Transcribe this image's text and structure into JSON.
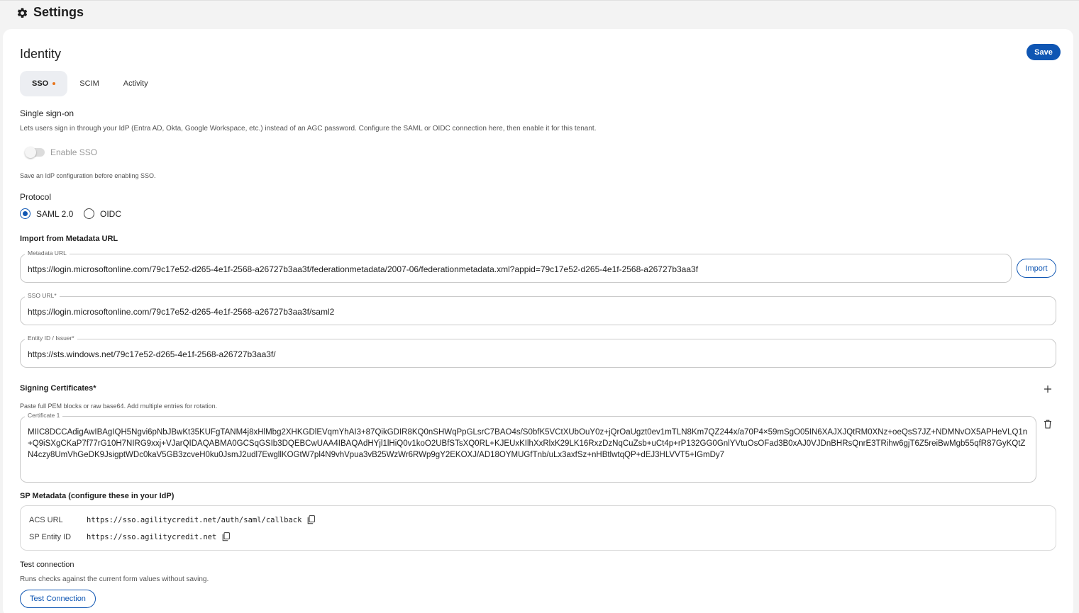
{
  "header": {
    "title": "Settings",
    "icon": "gear-icon"
  },
  "identity": {
    "title": "Identity",
    "save_label": "Save",
    "tabs": [
      {
        "label": "SSO",
        "active": true,
        "modified_indicator": true
      },
      {
        "label": "SCIM",
        "active": false
      },
      {
        "label": "Activity",
        "active": false
      }
    ]
  },
  "sso": {
    "title": "Single sign-on",
    "description": "Lets users sign in through your IdP (Entra AD, Okta, Google Workspace, etc.) instead of an AGC password. Configure the SAML or OIDC connection here, then enable it for this tenant.",
    "enable_label": "Enable SSO",
    "enabled": false,
    "enable_hint": "Save an IdP configuration before enabling SSO."
  },
  "protocol": {
    "label": "Protocol",
    "options": [
      "SAML 2.0",
      "OIDC"
    ],
    "selected": "SAML 2.0"
  },
  "metadata_import": {
    "title": "Import from Metadata URL",
    "field_label": "Metadata URL",
    "value": "https://login.microsoftonline.com/79c17e52-d265-4e1f-2568-a26727b3aa3f/federationmetadata/2007-06/federationmetadata.xml?appid=79c17e52-d265-4e1f-2568-a26727b3aa3f",
    "import_label": "Import"
  },
  "sso_url": {
    "label": "SSO URL*",
    "value": "https://login.microsoftonline.com/79c17e52-d265-4e1f-2568-a26727b3aa3f/saml2"
  },
  "entity_id": {
    "label": "Entity ID / Issuer*",
    "value": "https://sts.windows.net/79c17e52-d265-4e1f-2568-a26727b3aa3f/"
  },
  "certificates": {
    "title": "Signing Certificates*",
    "hint": "Paste full PEM blocks or raw base64. Add multiple entries for rotation.",
    "items": [
      {
        "label": "Certificate 1",
        "value": "MIIC8DCCAdigAwIBAgIQH5Ngvi6pNbJBwKt35KUFgTANM4j8xHlMbg2XHKGDlEVqmYhAI3+87QikGDIR8KQ0nSHWqPpGLsrC7BAO4s/S0bfK5VCtXUbOuY0z+jQrOaUgzt0ev1mTLN8Km7QZ244x/a70P4×59mSgO05IN6XAJXJQtRM0XNz+oeQsS7JZ+NDMNvOX5APHeVLQ1n+Q9iSXgCKaP7f77rG10H7NIRG9xxj+VJarQIDAQABMA0GCSqGSIb3DQEBCwUAA4IBAQAdHYjl1lHiQ0v1koO2UBfSTsXQ0RL+KJEUxKIlhXxRlxK29LK16RxzDzNqCuZsb+uCt4p+rP132GG0GnlYVtuOsOFad3B0xAJ0VJDnBHRsQnrE3TRihw6gjT6Z5reiBwMgb55qfR87GyKQtZN4czy8UmVhGeDK9JsigptWDc0kaV5GB3zcveH0ku0JsmJ2udl7EwgllKOGtW7pl4N9vhVpua3vB25WzWr6RWp9gY2EKOXJ/AD18OYMUGfTnb/uLx3axfSz+nHBtlwtqQP+dEJ3HLVVT5+IGmDy7"
      }
    ],
    "add_icon": "plus-icon",
    "delete_icon": "trash-icon"
  },
  "sp_metadata": {
    "title": "SP Metadata (configure these in your IdP)",
    "rows": [
      {
        "key": "ACS URL",
        "value": "https://sso.agilitycredit.net/auth/saml/callback"
      },
      {
        "key": "SP Entity ID",
        "value": "https://sso.agilitycredit.net"
      }
    ],
    "copy_icon": "copy-icon"
  },
  "test_connection": {
    "title": "Test connection",
    "description": "Runs checks against the current form values without saving.",
    "button_label": "Test Connection"
  },
  "colors": {
    "primary": "#0f56b3",
    "modified_dot": "#e8741a",
    "background": "#f3f3f3",
    "card": "#ffffff"
  }
}
